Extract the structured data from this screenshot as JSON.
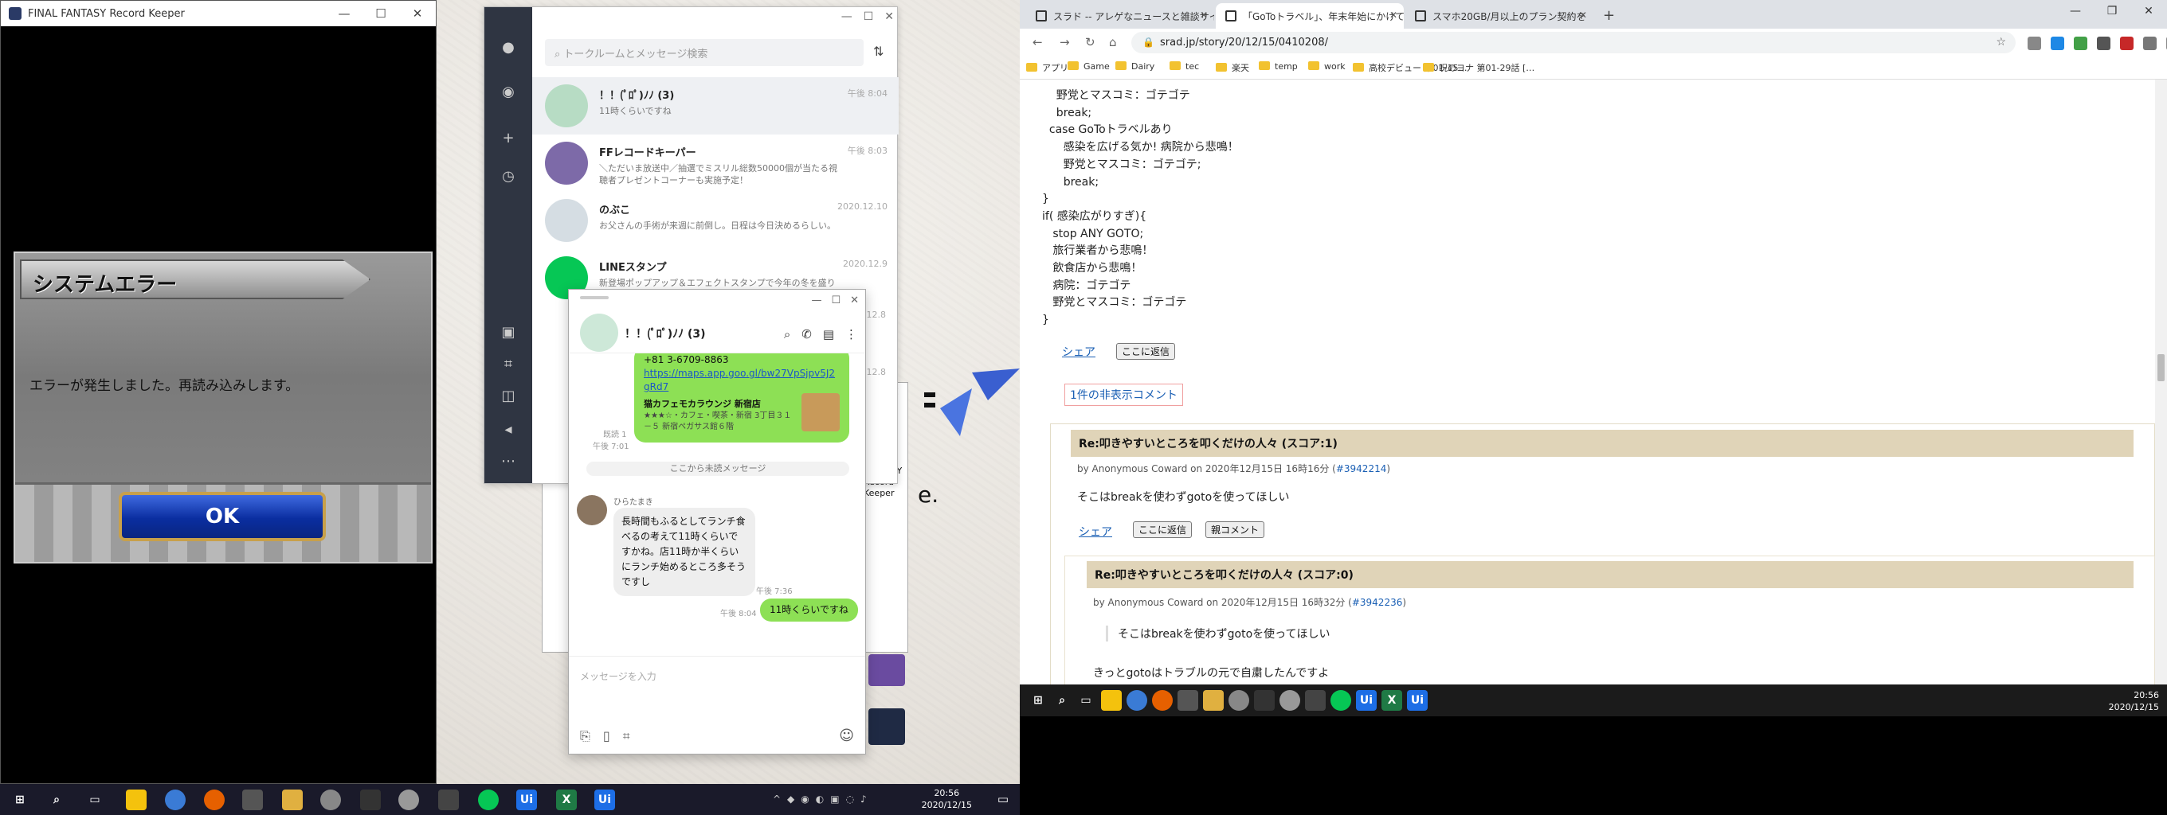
{
  "ffrk": {
    "title": "FINAL FANTASY Record Keeper",
    "error_title": "システムエラー",
    "error_message": "エラーが発生しました。再読み込みします。",
    "ok_label": "OK"
  },
  "line": {
    "search_placeholder": "トークルームとメッセージ検索",
    "chats": [
      {
        "name": "！！(ﾟﾛﾟ)ﾉﾉ (3)",
        "preview": "11時くらいですね",
        "time": "午後 8:04",
        "color": "#b7dcc4"
      },
      {
        "name": "FFレコードキーパー",
        "preview": "＼ただいま放送中／抽選でミスリル総数50000個が当たる視聴者プレゼントコーナーも実施予定！",
        "time": "午後 8:03",
        "color": "#7d6aa8"
      },
      {
        "name": "のぶこ",
        "preview": "お父さんの手術が来週に前倒し。日程は今日決めるらしい。",
        "time": "2020.12.10",
        "color": "#d5dde3"
      },
      {
        "name": "LINEスタンプ",
        "preview": "新登場ポップアップ＆エフェクトスタンプで今年の冬を盛り上げよう",
        "time": "2020.12.9",
        "color": "#06c755"
      }
    ],
    "time_extra_1": "2020.12.8",
    "time_extra_2": "2020.12.8"
  },
  "popup": {
    "group_name": "！！(ﾟﾛﾟ)ﾉﾉ (3)",
    "phone": "+81 3-6709-8863",
    "link": "https://maps.app.goo.gl/bw27VpSjpv5J2gRd7",
    "place_name": "猫カフェモカラウンジ 新宿店",
    "place_desc": "★★★☆・カフェ・喫茶・新宿 3丁目３１－５ 新宿ペガサス館６階",
    "read_label": "既読 1",
    "time_1": "午後 7:01",
    "unread_divider": "ここから未読メッセージ",
    "sender": "ひらたまき",
    "incoming": "長時間もふるとしてランチ食べるの考えて11時くらいですかね。店11時か半くらいにランチ始めるところ多そうですし",
    "time_2": "午後 7:36",
    "outgoing": "11時くらいですね",
    "time_3": "午後 8:04",
    "input_placeholder": "メッセージを入力"
  },
  "desktop": {
    "ffrk_label_1": "FINAL FANTASY",
    "ffrk_label_2": "Record Keeper",
    "partial_text": "e."
  },
  "taskbar_left": {
    "time": "20:56",
    "date": "2020/12/15"
  },
  "browser": {
    "tabs": [
      {
        "title": "スラド -- アレゲなニュースと雑談サイト"
      },
      {
        "title": "「GoToトラベル」、年末年始にかけて全国"
      },
      {
        "title": "スマホ20GB/月以上のプラン契約を"
      }
    ],
    "url": "srad.jp/story/20/12/15/0410208/",
    "bookmarks": [
      "アプリ",
      "Game",
      "Dairy",
      "tec",
      "楽天",
      "temp",
      "work",
      "高校デビュー 第01-15…",
      "呪のヨナ 第01-29話 […"
    ],
    "code_lines": [
      "    野党とマスコミ：ゴテゴテ",
      "    break;",
      "  case GoToトラベルあり",
      "      感染を広げる気か! 病院から悲鳴！",
      "      野党とマスコミ：ゴテゴテ;",
      "      break;",
      "}",
      "if( 感染広がりすぎ){",
      "   stop ANY GOTO;",
      "   旅行業者から悲鳴！",
      "   飲食店から悲鳴！",
      "   病院：ゴテゴテ",
      "   野党とマスコミ：ゴテゴテ",
      "}"
    ],
    "share": "シェア",
    "reply": "ここに返信",
    "parent": "親コメント",
    "hidden_comments": "1件の非表示コメント",
    "c1_title": "Re:叩きやすいところを叩くだけの人々 (スコア:1)",
    "c1_meta_pre": "by Anonymous Coward on 2020年12月15日 16時16分 (",
    "c1_id": "#3942214",
    "c1_body": "そこはbreakを使わずgotoを使ってほしい",
    "c2_title": "Re:叩きやすいところを叩くだけの人々 (スコア:0)",
    "c2_meta_pre": "by Anonymous Coward on 2020年12月15日 16時32分 (",
    "c2_id": "#3942236",
    "c2_quote": "そこはbreakを使わずgotoを使ってほしい",
    "c2_body": "きっとgotoはトラブルの元で自粛したんですよ"
  },
  "taskbar_right": {
    "time": "20:56",
    "date": "2020/12/15"
  }
}
